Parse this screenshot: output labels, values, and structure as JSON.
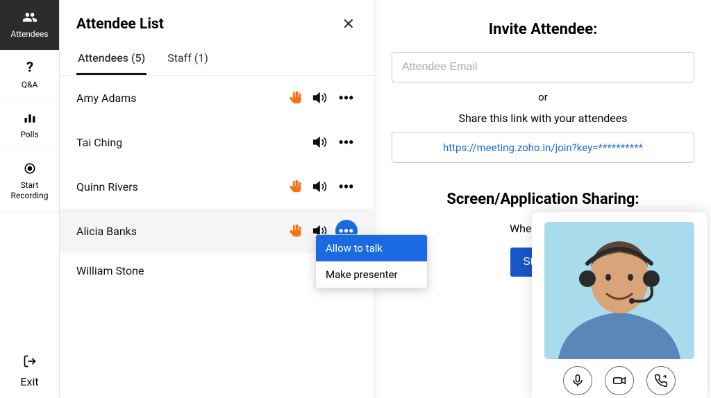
{
  "sidebar": {
    "items": [
      {
        "label": "Attendees",
        "icon": "attendees"
      },
      {
        "label": "Q&A",
        "icon": "question"
      },
      {
        "label": "Polls",
        "icon": "polls"
      },
      {
        "label": "Start\nRecording",
        "icon": "record"
      }
    ],
    "exit_label": "Exit"
  },
  "panel": {
    "title": "Attendee List",
    "tabs": [
      {
        "label": "Attendees (5)"
      },
      {
        "label": "Staff (1)"
      }
    ],
    "attendees": [
      {
        "name": "Amy Adams",
        "hand": true
      },
      {
        "name": "Tai Ching",
        "hand": false
      },
      {
        "name": "Quinn Rivers",
        "hand": true
      },
      {
        "name": "Alicia Banks",
        "hand": true,
        "menu_open": true
      },
      {
        "name": "William Stone",
        "hand": false
      }
    ],
    "menu": {
      "items": [
        "Allow to talk",
        "Make presenter"
      ]
    }
  },
  "main": {
    "invite_heading": "Invite Attendee:",
    "email_placeholder": "Attendee Email",
    "or_text": "or",
    "share_text": "Share this link with your attendees",
    "link": "https://meeting.zoho.in/join?key=**********",
    "sharing_heading": "Screen/Application Sharing:",
    "sharing_sub": "When you are",
    "start_button": "Start Sh"
  }
}
